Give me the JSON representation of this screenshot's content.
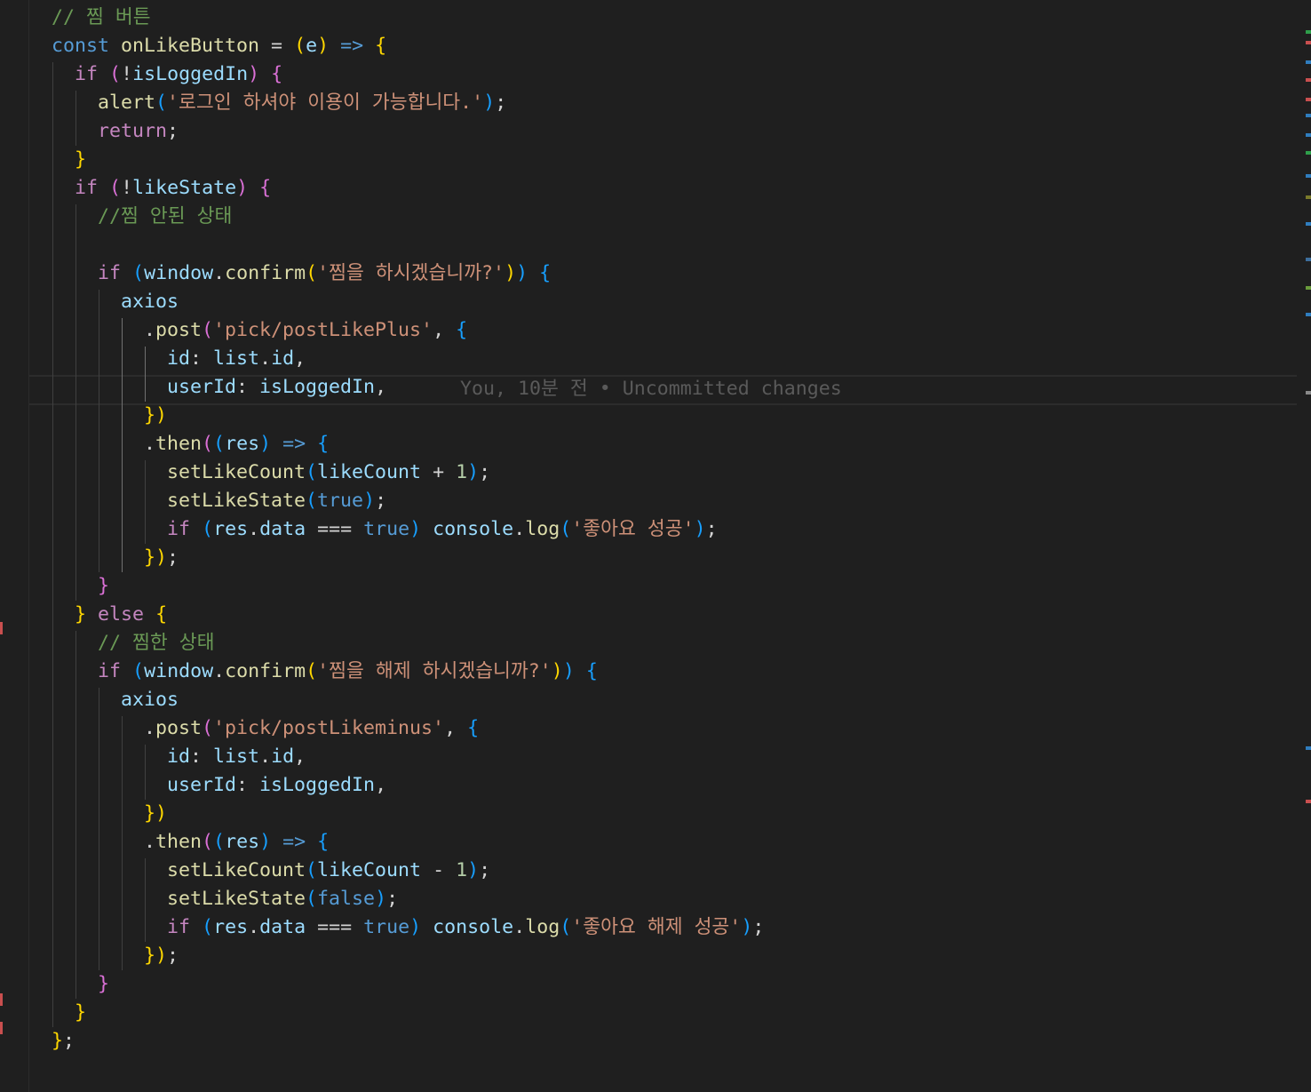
{
  "editor": {
    "blame": "You, 10분 전 • Uncommitted changes",
    "lines": [
      "// 찜 버튼",
      "const onLikeButton = (e) => {",
      "  if (!isLoggedIn) {",
      "    alert('로그인 하셔야 이용이 가능합니다.');",
      "    return;",
      "  }",
      "  if (!likeState) {",
      "    //찜 안된 상태",
      "",
      "    if (window.confirm('찜을 하시겠습니까?')) {",
      "      axios",
      "        .post('pick/postLikePlus', {",
      "          id: list.id,",
      "          userId: isLoggedIn,",
      "        })",
      "        .then((res) => {",
      "          setLikeCount(likeCount + 1);",
      "          setLikeState(true);",
      "          if (res.data === true) console.log('좋아요 성공');",
      "        });",
      "    }",
      "  } else {",
      "    // 찜한 상태",
      "    if (window.confirm('찜을 해제 하시겠습니까?')) {",
      "      axios",
      "        .post('pick/postLikeminus', {",
      "          id: list.id,",
      "          userId: isLoggedIn,",
      "        })",
      "        .then((res) => {",
      "          setLikeCount(likeCount - 1);",
      "          setLikeState(false);",
      "          if (res.data === true) console.log('좋아요 해제 성공');",
      "        });",
      "    }",
      "  }",
      "};"
    ]
  }
}
